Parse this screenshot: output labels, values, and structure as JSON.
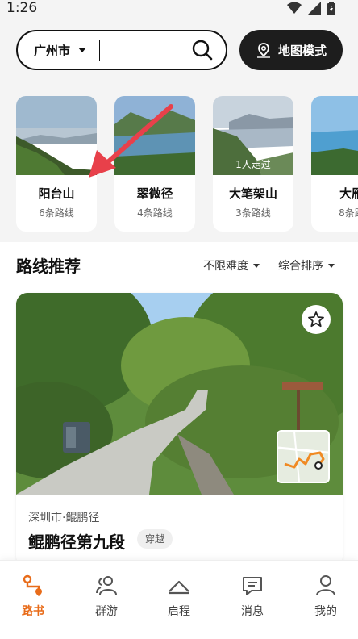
{
  "status": {
    "time": "1:26"
  },
  "search": {
    "city": "广州市",
    "placeholder": "",
    "map_mode_label": "地图模式"
  },
  "mountains": [
    {
      "name": "阳台山",
      "count": "6条路线",
      "badge": ""
    },
    {
      "name": "翠微径",
      "count": "4条路线",
      "badge": ""
    },
    {
      "name": "大笔架山",
      "count": "3条路线",
      "badge": "1人走过"
    },
    {
      "name": "大雁",
      "count": "8条路",
      "badge": ""
    }
  ],
  "section": {
    "title": "路线推荐",
    "filter_difficulty": "不限难度",
    "filter_sort": "综合排序"
  },
  "route": {
    "location": "深圳市·鲲鹏径",
    "title": "鲲鹏径第九段",
    "tag": "穿越"
  },
  "nav": [
    {
      "label": "路书",
      "icon": "route-book-icon",
      "active": true
    },
    {
      "label": "群游",
      "icon": "group-icon",
      "active": false
    },
    {
      "label": "启程",
      "icon": "start-icon",
      "active": false
    },
    {
      "label": "消息",
      "icon": "message-icon",
      "active": false
    },
    {
      "label": "我的",
      "icon": "profile-icon",
      "active": false
    }
  ],
  "colors": {
    "accent": "#e86c1a",
    "dark_button": "#1d1d1d",
    "arrow": "#e8404a"
  }
}
